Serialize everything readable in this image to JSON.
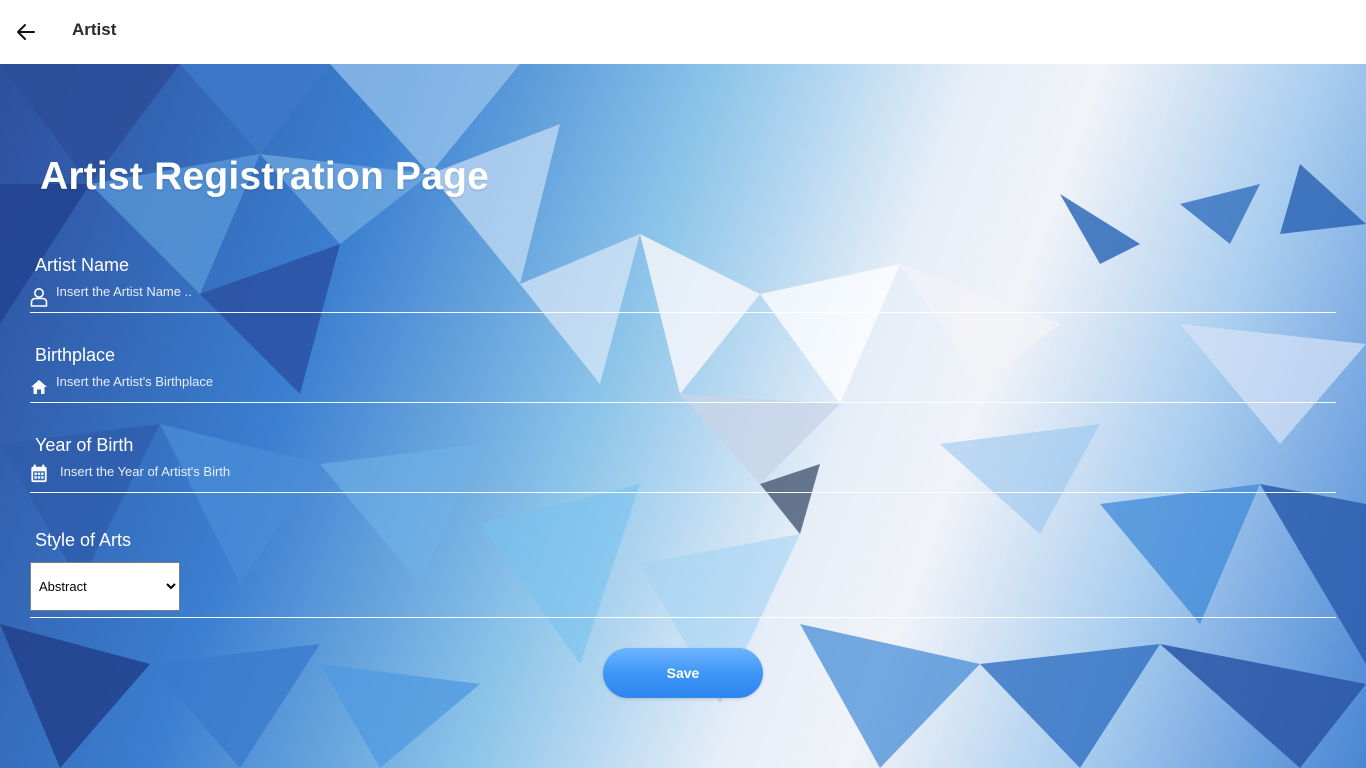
{
  "appbar": {
    "title": "Artist",
    "back_icon": "arrow-left-icon"
  },
  "form": {
    "heading": "Artist Registration Page",
    "artist_name": {
      "label": "Artist Name",
      "placeholder": "Insert the Artist Name ..",
      "icon": "user-icon",
      "value": ""
    },
    "birthplace": {
      "label": "Birthplace",
      "placeholder": "Insert the Artist's Birthplace",
      "icon": "home-icon",
      "value": ""
    },
    "year_of_birth": {
      "label": "Year of Birth",
      "placeholder": "Insert the Year of Artist's Birth",
      "icon": "calendar-icon",
      "value": ""
    },
    "style_of_arts": {
      "label": "Style of Arts",
      "selected": "Abstract"
    },
    "save_label": "Save"
  },
  "colors": {
    "accent": "#3b94f5",
    "background_primary": "#3b7fd0",
    "background_light": "#f1f3f8"
  }
}
